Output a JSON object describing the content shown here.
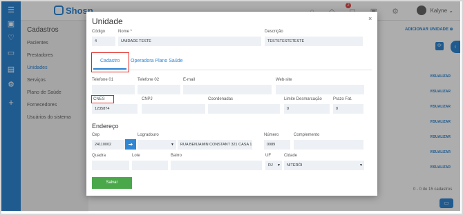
{
  "topbar": {
    "logo_text": "Shosp",
    "user_name": "Kalyne",
    "notification_count": "2"
  },
  "sidenav": {
    "title": "Cadastros",
    "items": [
      {
        "label": "Pacientes"
      },
      {
        "label": "Prestadores"
      },
      {
        "label": "Unidades"
      },
      {
        "label": "Serviços"
      },
      {
        "label": "Plano de Saúde"
      },
      {
        "label": "Fornecedores"
      },
      {
        "label": "Usuários do sistema"
      }
    ]
  },
  "background": {
    "add_label": "ADICIONAR UNIDADE ⊕",
    "visualizar_label": "VISUALIZAR",
    "count_text": "0 - 0 de 15 cadastros"
  },
  "modal": {
    "title": "Unidade",
    "close_glyph": "×",
    "fields": {
      "codigo": {
        "label": "Código",
        "value": "4"
      },
      "nome": {
        "label": "Nome *",
        "value": "UNIDADE TESTE"
      },
      "descricao": {
        "label": "Descrição",
        "value": "TESTSTESTETESTE"
      },
      "telefone1": {
        "label": "Telefone 01",
        "value": ""
      },
      "telefone2": {
        "label": "Telefone 02",
        "value": ""
      },
      "email": {
        "label": "E-mail",
        "value": ""
      },
      "website": {
        "label": "Web-site",
        "value": ""
      },
      "cnes": {
        "label": "CNES",
        "value": "1235874"
      },
      "cnpj": {
        "label": "CNPJ",
        "value": ""
      },
      "coordenadas": {
        "label": "Coordenadas",
        "value": ""
      },
      "limite": {
        "label": "Limite Desmarcação",
        "value": "0"
      },
      "prazo": {
        "label": "Prazo Fat.",
        "value": "0"
      },
      "cep": {
        "label": "Cep",
        "value": "24110002"
      },
      "logradouro": {
        "label": "Logradouro",
        "value": "RUA BENJAMIN CONSTANT 321 CASA 1"
      },
      "numero": {
        "label": "Número",
        "value": "0089"
      },
      "complemento": {
        "label": "Complemento",
        "value": ""
      },
      "quadra": {
        "label": "Quadra",
        "value": ""
      },
      "lote": {
        "label": "Lote",
        "value": ""
      },
      "bairro": {
        "label": "Bairro",
        "value": ""
      },
      "uf": {
        "label": "UF",
        "value": "RJ"
      },
      "cidade": {
        "label": "Cidade",
        "value": "NITERÓI"
      }
    },
    "tabs": [
      {
        "label": "Cadastro"
      },
      {
        "label": "Operadora Plano Saúde"
      }
    ],
    "section_endereco": "Endereço",
    "save_label": "Salvar"
  },
  "colors": {
    "primary": "#2f86d3",
    "highlight_box": "#e0221d",
    "save_button": "#4aa84a"
  }
}
